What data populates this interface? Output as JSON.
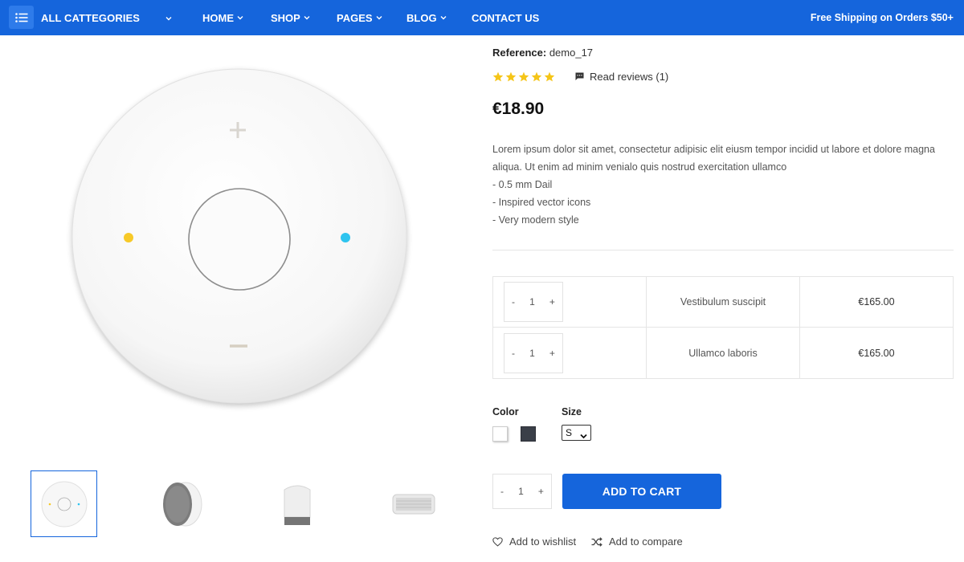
{
  "nav": {
    "categories_label": "ALL CATTEGORIES",
    "items": [
      {
        "label": "HOME"
      },
      {
        "label": "SHOP"
      },
      {
        "label": "PAGES"
      },
      {
        "label": "BLOG"
      },
      {
        "label": "CONTACT US"
      }
    ],
    "promo": "Free Shipping on Orders $50+"
  },
  "product": {
    "reference_label": "Reference:",
    "reference_value": "demo_17",
    "rating": 5,
    "reviews_label": "Read reviews (1)",
    "price": "€18.90",
    "description_lines": [
      "Lorem ipsum dolor sit amet, consectetur adipisic elit eiusm tempor incidid ut labore et dolore magna aliqua. Ut enim ad minim venialo quis nostrud exercitation ullamco",
      "- 0.5 mm Dail",
      "- Inspired vector icons",
      "- Very modern style"
    ]
  },
  "pack": [
    {
      "qty_minus": "-",
      "qty": "1",
      "qty_plus": "+",
      "name": "Vestibulum suscipit",
      "price": "€165.00"
    },
    {
      "qty_minus": "-",
      "qty": "1",
      "qty_plus": "+",
      "name": "Ullamco laboris",
      "price": "€165.00"
    }
  ],
  "variants": {
    "color_label": "Color",
    "colors": [
      "#ffffff",
      "#3a3f48"
    ],
    "size_label": "Size",
    "size_selected": "S"
  },
  "cart": {
    "qty_minus": "-",
    "qty": "1",
    "qty_plus": "+",
    "button_label": "ADD TO CART",
    "wishlist_label": "Add to wishlist",
    "compare_label": "Add to compare"
  },
  "theme": {
    "accent": "#1565dc",
    "star": "#f5c518"
  }
}
